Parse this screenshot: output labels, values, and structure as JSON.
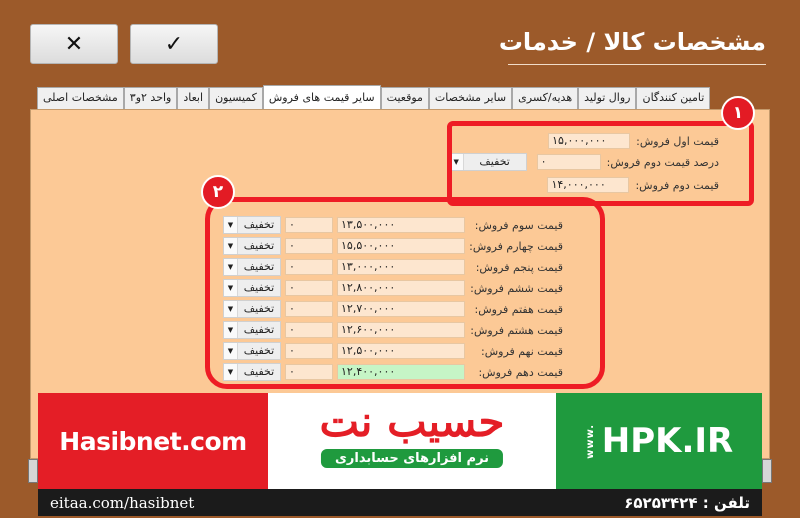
{
  "header": {
    "title": "مشخصات کالا / خدمات",
    "confirm_icon": "✓",
    "cancel_icon": "✕"
  },
  "tabs": [
    {
      "label": "مشخصات اصلی",
      "active": false
    },
    {
      "label": "واحد ۲و۳",
      "active": false
    },
    {
      "label": "ابعاد",
      "active": false
    },
    {
      "label": "کمیسیون",
      "active": false
    },
    {
      "label": "سایر قیمت های فروش",
      "active": true
    },
    {
      "label": "موقعیت",
      "active": false
    },
    {
      "label": "سایر مشخصات",
      "active": false
    },
    {
      "label": "هدیه/کسری",
      "active": false
    },
    {
      "label": "روال تولید",
      "active": false
    },
    {
      "label": "تامین کنندگان",
      "active": false
    }
  ],
  "section1": {
    "badge": "۱",
    "first_price_label": "قیمت اول فروش:",
    "first_price_value": "۱۵,۰۰۰,۰۰۰",
    "second_percent_label": "درصد قیمت دوم فروش:",
    "second_percent_value": "۰",
    "second_mode": "تخفیف",
    "second_price_label": "قیمت دوم فروش:",
    "second_price_value": "۱۴,۰۰۰,۰۰۰"
  },
  "section2": {
    "badge": "۲",
    "rows": [
      {
        "label": "قیمت سوم فروش:",
        "value": "۱۳,۵۰۰,۰۰۰",
        "percent": "۰",
        "mode": "تخفیف"
      },
      {
        "label": "قیمت چهارم فروش:",
        "value": "۱۵,۵۰۰,۰۰۰",
        "percent": "۰",
        "mode": "تخفیف"
      },
      {
        "label": "قیمت پنجم فروش:",
        "value": "۱۳,۰۰۰,۰۰۰",
        "percent": "۰",
        "mode": "تخفیف"
      },
      {
        "label": "قیمت ششم فروش:",
        "value": "۱۲,۸۰۰,۰۰۰",
        "percent": "۰",
        "mode": "تخفیف"
      },
      {
        "label": "قیمت هفتم فروش:",
        "value": "۱۲,۷۰۰,۰۰۰",
        "percent": "۰",
        "mode": "تخفیف"
      },
      {
        "label": "قیمت هشتم فروش:",
        "value": "۱۲,۶۰۰,۰۰۰",
        "percent": "۰",
        "mode": "تخفیف"
      },
      {
        "label": "قیمت نهم فروش:",
        "value": "۱۲,۵۰۰,۰۰۰",
        "percent": "۰",
        "mode": "تخفیف"
      },
      {
        "label": "قیمت دهم فروش:",
        "value": "۱۲,۴۰۰,۰۰۰",
        "percent": "۰",
        "mode": "تخفیف",
        "highlight": true
      }
    ]
  },
  "banner": {
    "site": "Hasibnet.com",
    "logo": "حسیب نت",
    "slogan": "نرم افزارهای حسابداری",
    "www": "www.",
    "hpk": "HPK.IR",
    "eitaa": "eitaa.com/hasibnet",
    "tel": "تلفن : ۶۵۲۵۳۴۲۴"
  },
  "colors": {
    "background": "#9c5a2a",
    "panel": "#fcc996",
    "highlight": "#ee1c25",
    "brand_red": "#e41e26",
    "brand_green": "#1f9a3e"
  }
}
